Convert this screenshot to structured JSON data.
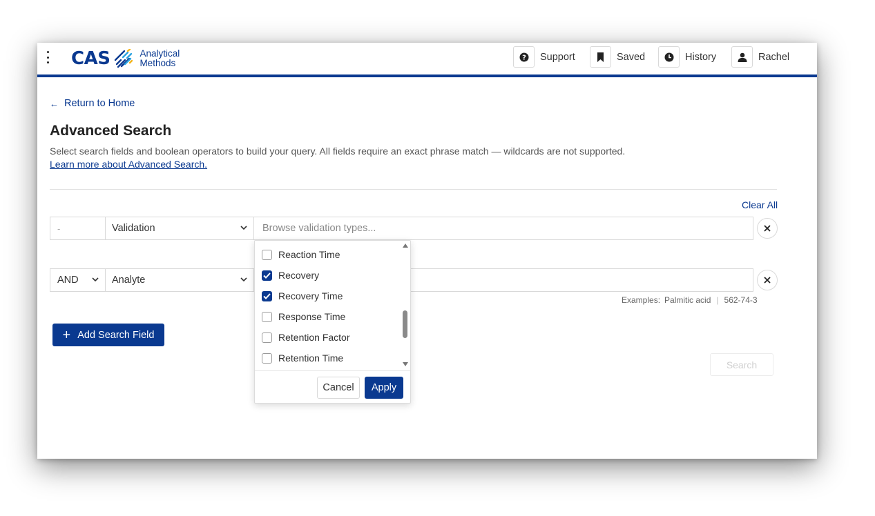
{
  "header": {
    "logo": {
      "brand": "CAS",
      "line1": "Analytical",
      "line2": "Methods"
    },
    "buttons": [
      {
        "label": "Support",
        "icon": "help-circle-icon"
      },
      {
        "label": "Saved",
        "icon": "bookmark-icon"
      },
      {
        "label": "History",
        "icon": "clock-icon"
      },
      {
        "label": "Rachel",
        "icon": "user-icon"
      }
    ]
  },
  "nav": {
    "return_label": "Return to Home"
  },
  "page": {
    "title": "Advanced Search",
    "description": "Select search fields and boolean operators to build your query. All fields require an exact phrase match — wildcards are not supported.",
    "learn_more": "Learn more about Advanced Search."
  },
  "query": {
    "clear_all": "Clear All",
    "rows": [
      {
        "operator": "-",
        "field": "Validation",
        "placeholder": "Browse validation types..."
      },
      {
        "operator": "AND",
        "field": "Analyte",
        "placeholder": ""
      }
    ],
    "examples": {
      "label": "Examples:",
      "values": [
        "Palmitic acid",
        "562-74-3"
      ]
    }
  },
  "dropdown": {
    "items": [
      {
        "label": "Reaction Time",
        "checked": false
      },
      {
        "label": "Recovery",
        "checked": true
      },
      {
        "label": "Recovery Time",
        "checked": true
      },
      {
        "label": "Response Time",
        "checked": false
      },
      {
        "label": "Retention Factor",
        "checked": false
      },
      {
        "label": "Retention Time",
        "checked": false
      }
    ],
    "cancel": "Cancel",
    "apply": "Apply"
  },
  "actions": {
    "add_field": "Add Search Field",
    "search": "Search"
  },
  "colors": {
    "primary": "#0a3990",
    "border": "#d9d9d9"
  }
}
